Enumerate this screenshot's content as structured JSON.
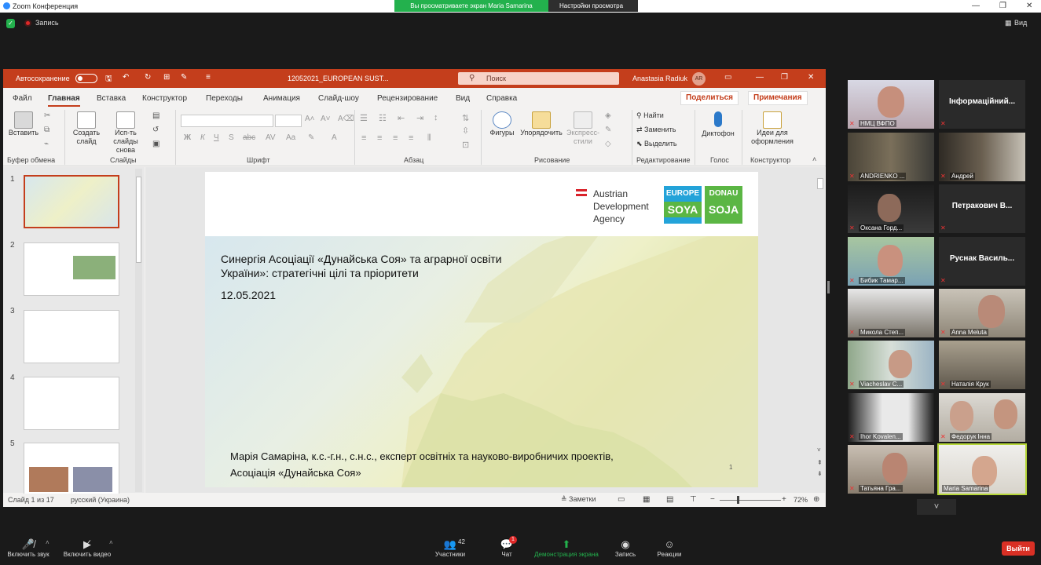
{
  "window": {
    "title": "Zoom Конференция"
  },
  "zoom": {
    "view_banner": "Вы просматриваете экран Maria Samarina",
    "view_options": "Настройки просмотра",
    "record": "Запись",
    "view": "Вид"
  },
  "ppt": {
    "autosave": "Автосохранение",
    "filename": "12052021_EUROPEAN SUST...",
    "search_placeholder": "Поиск",
    "user": "Anastasia Radiuk",
    "avatar": "AR",
    "menu": [
      "Файл",
      "Главная",
      "Вставка",
      "Конструктор",
      "Переходы",
      "Анимация",
      "Слайд-шоу",
      "Рецензирование",
      "Вид",
      "Справка"
    ],
    "share": "Поделиться",
    "comments": "Примечания",
    "ribbon": {
      "paste": "Вставить",
      "clipboard": "Буфер обмена",
      "create_slide_1": "Создать",
      "create_slide_2": "слайд",
      "reuse_1": "Исп-ть",
      "reuse_2": "слайды снова",
      "slides": "Слайды",
      "font_group": "Шрифт",
      "para_group": "Абзац",
      "shapes": "Фигуры",
      "arrange": "Упорядочить",
      "quick_1": "Экспресс-",
      "quick_2": "стили",
      "drawing": "Рисование",
      "find": "Найти",
      "replace": "Заменить",
      "select": "Выделить",
      "editing": "Редактирование",
      "dictate": "Диктофон",
      "voice": "Голос",
      "ideas_1": "Идеи для",
      "ideas_2": "оформления",
      "designer": "Конструктор"
    },
    "slide": {
      "ada_1": "Austrian",
      "ada_2": "Development",
      "ada_3": "Agency",
      "logo_europe_1": "EUROPE",
      "logo_europe_2": "SOYA",
      "logo_donau_1": "DONAU",
      "logo_donau_2": "SOJA",
      "title_1": "Синергія Асоціації «Дунайська Соя» та аграрної освіти",
      "title_2": "України»: стратегічні цілі та пріоритети",
      "date": "12.05.2021",
      "author_1": "Марія Самаріна, к.с.-г.н., с.н.с., експерт освітніх та науково-виробничих проектів,",
      "author_2": "Асоціація «Дунайська Соя»",
      "number": "1"
    },
    "thumb_numbers": [
      "1",
      "2",
      "3",
      "4",
      "5"
    ],
    "status": {
      "slide": "Слайд 1 из 17",
      "lang": "русский (Украина)",
      "notes": "Заметки",
      "zoom": "72%"
    }
  },
  "participants": [
    {
      "name": "НМЦ ВФПО",
      "big": ""
    },
    {
      "name": "",
      "big": "Інформаційний..."
    },
    {
      "name": "ANDRIENKO ...",
      "big": ""
    },
    {
      "name": "Андрей",
      "big": ""
    },
    {
      "name": "Оксана Горд...",
      "big": ""
    },
    {
      "name": "",
      "big": "Петракович В..."
    },
    {
      "name": "Бибик Тамар...",
      "big": ""
    },
    {
      "name": "",
      "big": "Руснак Василь..."
    },
    {
      "name": "Микола Степ...",
      "big": ""
    },
    {
      "name": "Anna Meluta",
      "big": ""
    },
    {
      "name": "Viacheslav C...",
      "big": ""
    },
    {
      "name": "Наталія Крук",
      "big": ""
    },
    {
      "name": "Ihor Kovalen...",
      "big": ""
    },
    {
      "name": "Федорук Інна",
      "big": ""
    },
    {
      "name": "Татьяна Гра...",
      "big": ""
    },
    {
      "name": "Maria Samarina",
      "big": ""
    }
  ],
  "bottom": {
    "mute": "Включить звук",
    "video": "Включить видео",
    "participants": "Участники",
    "participants_count": "42",
    "chat": "Чат",
    "chat_badge": "1",
    "share": "Демонстрация экрана",
    "record": "Запись",
    "reactions": "Реакции",
    "exit": "Выйти"
  }
}
